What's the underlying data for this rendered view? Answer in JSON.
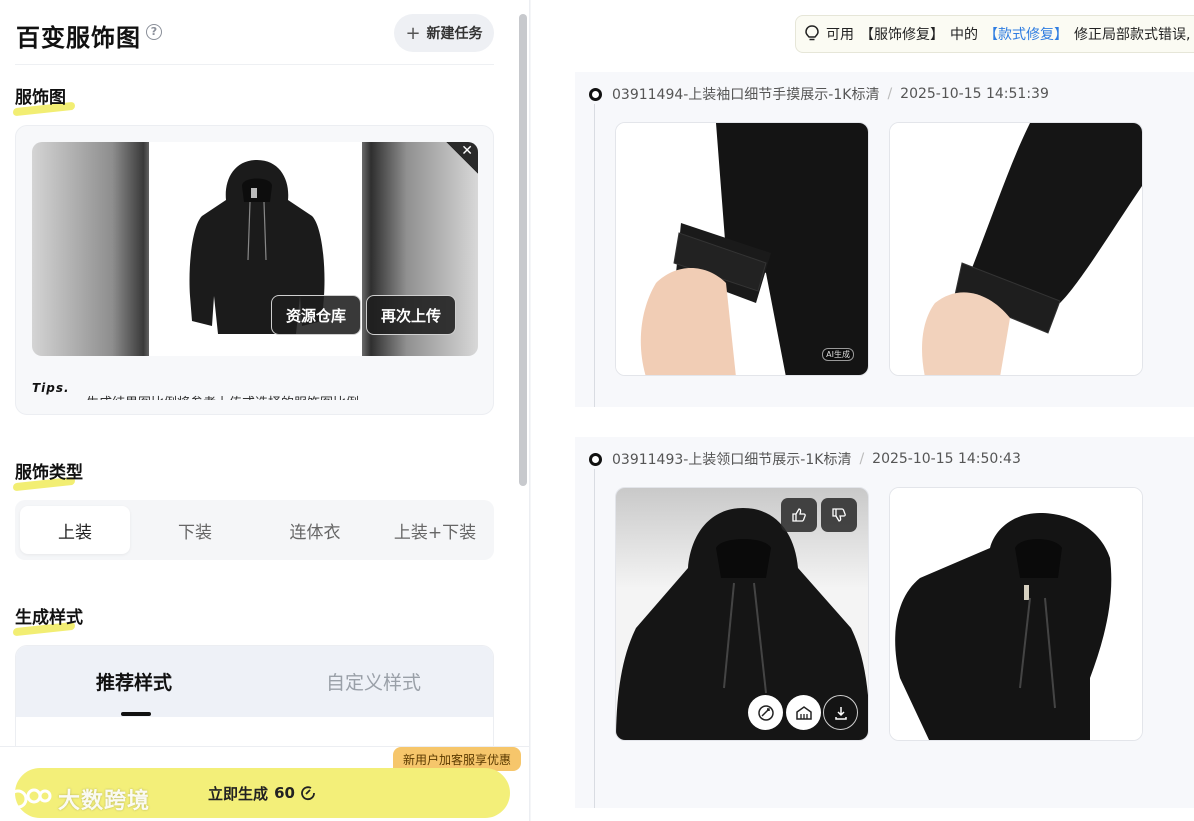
{
  "header": {
    "title": "百变服饰图",
    "help_icon": "question-circle-icon",
    "new_task_label": "新建任务"
  },
  "garment_image": {
    "section_title": "服饰图",
    "btn_library": "资源仓库",
    "btn_reupload": "再次上传",
    "tips_label": "Tips.",
    "tips_text": "生成结果图比例将参考上传或选择的服饰图比例"
  },
  "garment_type": {
    "section_title": "服饰类型",
    "options": [
      "上装",
      "下装",
      "连体衣",
      "上装+下装"
    ],
    "selected": "上装"
  },
  "generate_style": {
    "section_title": "生成样式",
    "tabs": [
      "推荐样式",
      "自定义样式"
    ],
    "active_tab": "推荐样式"
  },
  "footer": {
    "promo": "新用户加客服享优惠",
    "generate_label": "立即生成",
    "cost": "60",
    "watermark": "大数跨境"
  },
  "notice": {
    "prefix": "可用",
    "link1": "【服饰修复】",
    "middle": "中的",
    "link2": "【款式修复】",
    "suffix": "修正局部款式错误,"
  },
  "tasks": [
    {
      "name": "03911494-上装袖口细节手摸展示-1K标清",
      "time": "2025-10-15 14:51:39",
      "ai_tag": "AI生成"
    },
    {
      "name": "03911493-上装领口细节展示-1K标清",
      "time": "2025-10-15 14:50:43"
    }
  ],
  "colors": {
    "accent_yellow": "#f3ef79",
    "link_blue": "#2f7de1",
    "promo_orange": "#f6c66b"
  }
}
